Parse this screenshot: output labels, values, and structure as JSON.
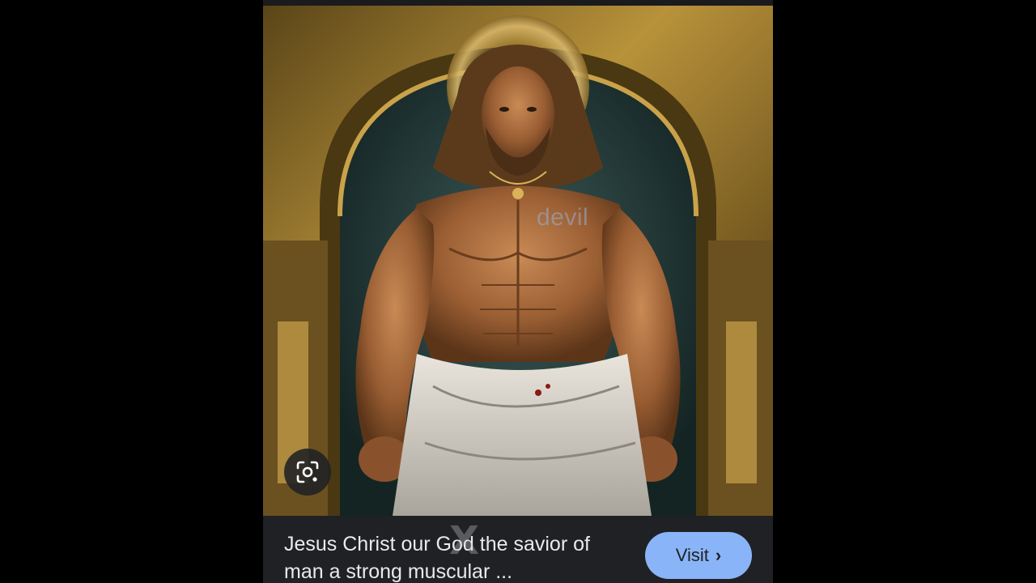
{
  "image": {
    "watermark_text": "devil",
    "alt_icon": "lens-camera-icon"
  },
  "result": {
    "title": "Jesus Christ our God the savior of man a strong muscular ...",
    "overlay_mark": "X",
    "visit_label": "Visit",
    "visit_icon": "chevron-right-icon"
  },
  "colors": {
    "background": "#000000",
    "panel": "#202124",
    "text": "#e8eaed",
    "button": "#8ab4f8"
  }
}
